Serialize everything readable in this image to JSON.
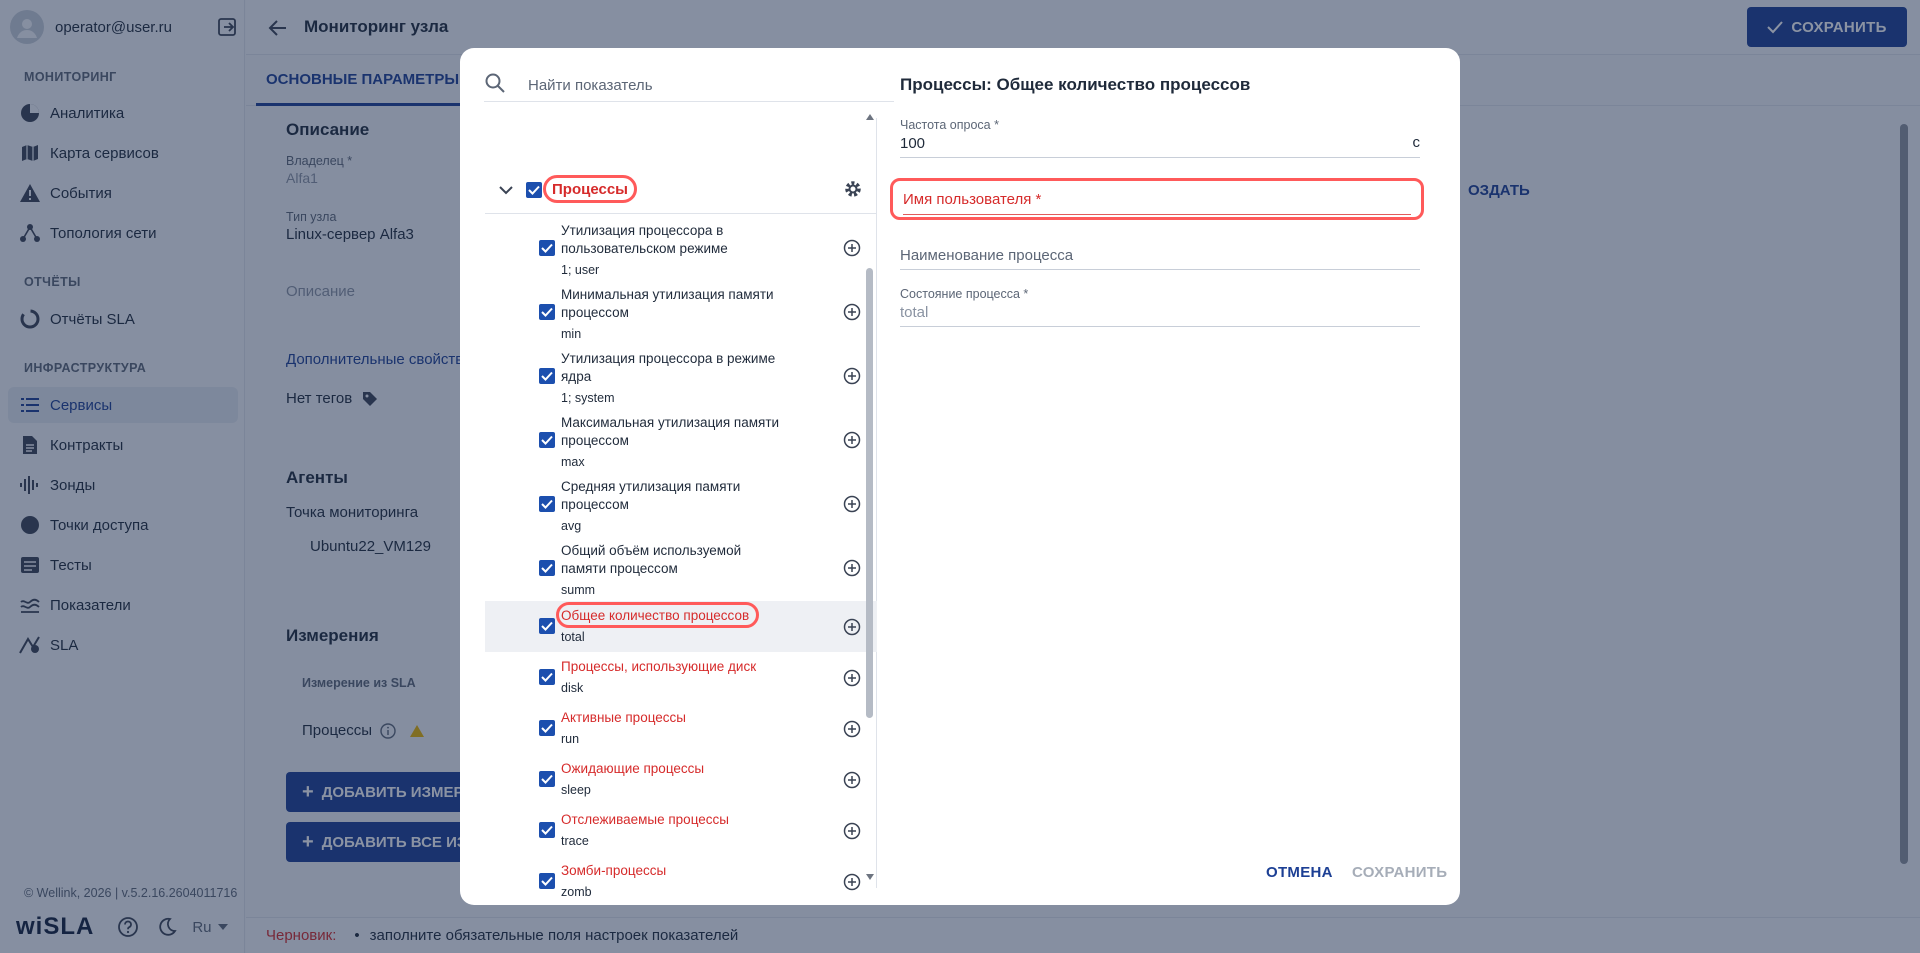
{
  "sidebar": {
    "user_email": "operator@user.ru",
    "sections": [
      {
        "title": "МОНИТОРИНГ",
        "items": [
          {
            "label": "Аналитика",
            "icon": "pie-chart-icon"
          },
          {
            "label": "Карта сервисов",
            "icon": "map-icon"
          },
          {
            "label": "События",
            "icon": "warning-icon"
          },
          {
            "label": "Топология сети",
            "icon": "topology-icon"
          }
        ]
      },
      {
        "title": "ОТЧЁТЫ",
        "items": [
          {
            "label": "Отчёты SLA",
            "icon": "sla-report-icon"
          }
        ]
      },
      {
        "title": "ИНФРАСТРУКТУРА",
        "items": [
          {
            "label": "Сервисы",
            "icon": "list-icon"
          },
          {
            "label": "Контракты",
            "icon": "document-icon"
          },
          {
            "label": "Зонды",
            "icon": "probe-icon"
          },
          {
            "label": "Точки доступа",
            "icon": "access-point-icon"
          },
          {
            "label": "Тесты",
            "icon": "tests-icon"
          },
          {
            "label": "Показатели",
            "icon": "metrics-icon"
          },
          {
            "label": "SLA",
            "icon": "sla-icon"
          }
        ]
      }
    ],
    "copyright": "© Wellink, 2026 | v.5.2.16.2604011716",
    "logo": "wiSLA",
    "language": "Ru"
  },
  "header": {
    "title": "Мониторинг узла",
    "save_label": "СОХРАНИТЬ"
  },
  "tabs": [
    "ОСНОВНЫЕ ПАРАМЕТРЫ"
  ],
  "page": {
    "description_heading": "Описание",
    "owner_label": "Владелец *",
    "owner_value": "Alfa1",
    "node_type_label": "Тип узла",
    "node_type_value": "Linux-сервер Alfa3",
    "description_placeholder": "Описание",
    "extra_props_link": "Дополнительные свойства",
    "no_tags": "Нет тегов",
    "agents_heading": "Агенты",
    "monitoring_point_label": "Точка мониторинга",
    "monitoring_point_value": "Ubuntu22_VM129",
    "measurements_heading": "Измерения",
    "measurement_col": "Измерение из SLA",
    "measurement_row": "Процессы",
    "add_measure_btn": "ДОБАВИТЬ ИЗМЕРЕ",
    "add_all_btn": "ДОБАВИТЬ ВСЕ ИЗ",
    "create_link": "ОЗДАТЬ"
  },
  "draft": {
    "label": "Черновик:",
    "message": "заполните обязательные поля настроек показателей"
  },
  "modal": {
    "search_placeholder": "Найти показатель",
    "group_label": "Процессы",
    "items": [
      {
        "title": "Утилизация процессора в пользовательском режиме",
        "code": "1; user",
        "warn": false
      },
      {
        "title": "Минимальная утилизация памяти процессом",
        "code": "min",
        "warn": false
      },
      {
        "title": "Утилизация процессора в режиме ядра",
        "code": "1; system",
        "warn": false
      },
      {
        "title": "Максимальная утилизация памяти процессом",
        "code": "max",
        "warn": false
      },
      {
        "title": "Средняя утилизация памяти процессом",
        "code": "avg",
        "warn": false
      },
      {
        "title": "Общий объём используемой памяти процессом",
        "code": "summ",
        "warn": false
      },
      {
        "title": "Общее количество процессов",
        "code": "total",
        "warn": true
      },
      {
        "title": "Процессы, использующие диск",
        "code": "disk",
        "warn": true
      },
      {
        "title": "Активные процессы",
        "code": "run",
        "warn": true
      },
      {
        "title": "Ожидающие процессы",
        "code": "sleep",
        "warn": true
      },
      {
        "title": "Отслеживаемые процессы",
        "code": "trace",
        "warn": true
      },
      {
        "title": "Зомби-процессы",
        "code": "zomb",
        "warn": true
      }
    ],
    "detail": {
      "title": "Процессы: Общее количество процессов",
      "poll_label": "Частота опроса *",
      "poll_value": "100",
      "poll_unit": "с",
      "username_label": "Имя пользователя *",
      "process_name_placeholder": "Наименование процесса",
      "process_state_label": "Состояние процесса *",
      "process_state_value": "total"
    },
    "cancel_label": "ОТМЕНА",
    "save_label": "СОХРАНИТЬ"
  },
  "colors": {
    "primary": "#1c3f94",
    "error": "#d62b2b",
    "highlight": "#ff5a5a"
  }
}
